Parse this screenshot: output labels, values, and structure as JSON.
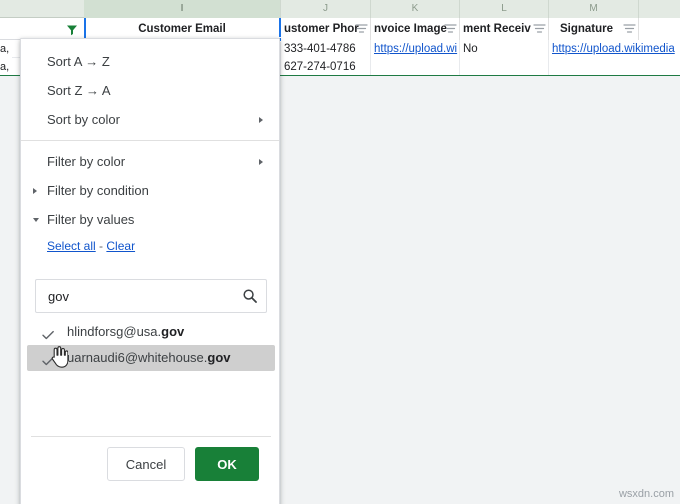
{
  "spreadsheet": {
    "column_letters": [
      "I",
      "J",
      "K",
      "L",
      "M"
    ],
    "headers": [
      {
        "letter": "I",
        "label": "Customer Email",
        "selected": true
      },
      {
        "letter": "J",
        "label": "ustomer Phor",
        "selected": false
      },
      {
        "letter": "K",
        "label": "nvoice Image",
        "selected": false
      },
      {
        "letter": "L",
        "label": "ment Receiv",
        "selected": false
      },
      {
        "letter": "M",
        "label": "Signature",
        "selected": false
      }
    ],
    "rows": [
      {
        "customer_phone": "333-401-4786",
        "invoice_image": "https://upload.wi",
        "payment_received": "No",
        "signature": "https://upload.wikimedia"
      },
      {
        "customer_phone": "627-274-0716",
        "invoice_image": "",
        "payment_received": "",
        "signature": ""
      }
    ],
    "left_fragments": [
      "a,",
      "a,"
    ]
  },
  "filter_menu": {
    "sort_az": "Sort A → Z",
    "sort_za": "Sort Z → A",
    "sort_by_color": "Sort by color",
    "filter_by_color": "Filter by color",
    "filter_by_condition": "Filter by condition",
    "filter_by_values": "Filter by values",
    "select_all": "Select all",
    "separator": "-",
    "clear": "Clear",
    "search": {
      "value": "gov",
      "placeholder": ""
    },
    "values": [
      {
        "prefix": "hlindforsg@usa.",
        "match": "gov",
        "suffix": "",
        "checked": true,
        "highlighted": false
      },
      {
        "prefix": "uarnaudi6@whitehouse.",
        "match": "gov",
        "suffix": "",
        "checked": true,
        "highlighted": true
      }
    ],
    "buttons": {
      "cancel": "Cancel",
      "ok": "OK"
    }
  },
  "watermark": "wsxdn.com",
  "colors": {
    "accent_green": "#188038",
    "header_green": "#e3eae3",
    "link_blue": "#1155cc",
    "selection_blue": "#1a73e8",
    "highlight_gray": "#cfcfcf"
  }
}
